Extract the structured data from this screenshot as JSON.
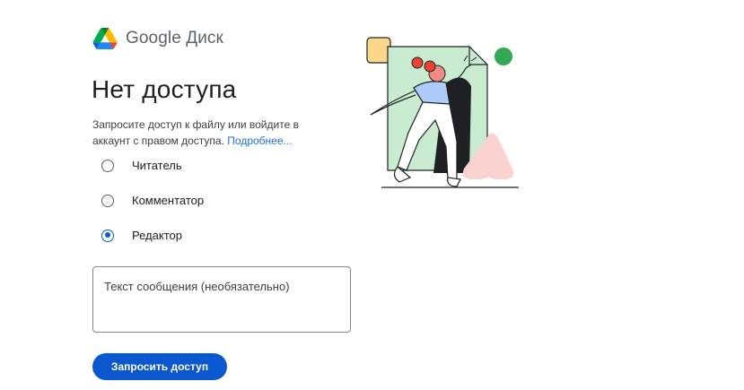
{
  "brand": {
    "name": "Google Диск",
    "logo_icon": "google-drive-logo-icon"
  },
  "page": {
    "title": "Нет доступа",
    "description": "Запросите доступ к файлу или войдите в аккаунт с правом доступа.",
    "learn_more": "Подробнее..."
  },
  "roles": [
    {
      "label": "Читатель",
      "selected": false
    },
    {
      "label": "Комментатор",
      "selected": false
    },
    {
      "label": "Редактор",
      "selected": true
    }
  ],
  "message": {
    "placeholder": "Текст сообщения (необязательно)",
    "value": ""
  },
  "request_button": {
    "label": "Запросить доступ"
  },
  "colors": {
    "accent": "#0b57d0",
    "link": "#1a73e8",
    "illustration_green": "#34a853"
  }
}
